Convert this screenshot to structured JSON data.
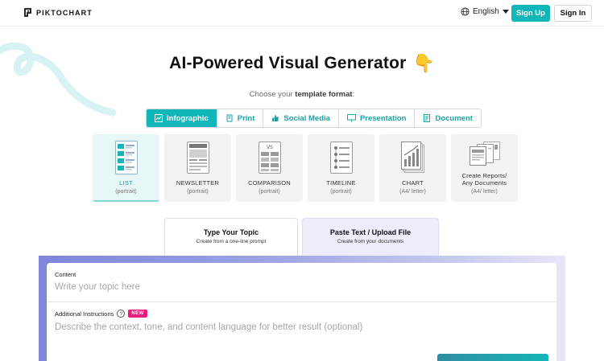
{
  "header": {
    "brand": "PIKTOCHART",
    "language": "English",
    "signup_label": "Sign Up",
    "signin_label": "Sign In"
  },
  "hero": {
    "title": "AI-Powered Visual Generator",
    "title_emoji": "👇",
    "subtitle_prefix": "Choose your",
    "subtitle_bold": "template format",
    "subtitle_suffix": ":"
  },
  "format_tabs": [
    {
      "label": "Infographic",
      "icon": "infographic-icon",
      "active": true
    },
    {
      "label": "Print",
      "icon": "print-icon",
      "active": false
    },
    {
      "label": "Social Media",
      "icon": "thumbs-up-icon",
      "active": false
    },
    {
      "label": "Presentation",
      "icon": "presentation-icon",
      "active": false
    },
    {
      "label": "Document",
      "icon": "document-icon",
      "active": false
    }
  ],
  "templates": [
    {
      "name": "LIST",
      "sub": "(portrait)",
      "icon": "list-template-icon",
      "active": true
    },
    {
      "name": "NEWSLETTER",
      "sub": "(portrait)",
      "icon": "newsletter-template-icon",
      "active": false
    },
    {
      "name": "COMPARISON",
      "sub": "(portrait)",
      "icon": "comparison-template-icon",
      "active": false
    },
    {
      "name": "TIMELINE",
      "sub": "(portrait)",
      "icon": "timeline-template-icon",
      "active": false
    },
    {
      "name": "CHART",
      "sub": "(A4/ letter)",
      "icon": "chart-template-icon",
      "active": false
    },
    {
      "name": "Create Reports/ Any Documents",
      "sub": "(A4/ letter)",
      "icon": "reports-template-icon",
      "active": false
    }
  ],
  "input_modes": [
    {
      "title": "Type Your Topic",
      "sub": "Create from a one-line prompt",
      "active": true
    },
    {
      "title": "Paste Text / Upload File",
      "sub": "Create from your documents",
      "active": false
    }
  ],
  "form": {
    "content_label": "Content",
    "content_placeholder": "Write your topic here",
    "additional_label": "Additional Instructions",
    "help_glyph": "?",
    "new_badge": "NEW",
    "additional_placeholder": "Describe the context, tone, and content language for better result (optional)"
  },
  "colors": {
    "accent": "#10b6b8",
    "badge": "#ec1c7c",
    "panel_gradient_start": "#7f86d9"
  }
}
